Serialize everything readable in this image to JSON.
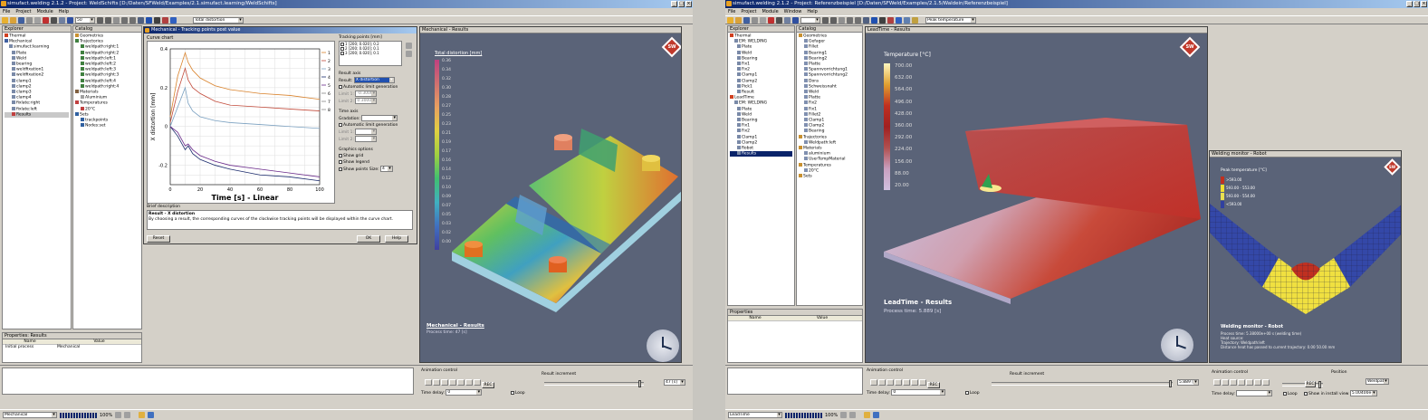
{
  "left_app": {
    "title": "simufact.welding 2.1.2 - Project: WeldSchifts [D:/Daten/SFWeld/Examples/2.1.simufact.learning/WeldSchifts]",
    "menu": [
      "File",
      "Project",
      "Module",
      "Help"
    ],
    "toolbar_combo_zoom": "50",
    "toolbar_combo_result": "Total distortion",
    "explorer": {
      "header": "Explorer",
      "items": [
        "Thermal",
        "Mechanical",
        "simufact:learning",
        "Plate",
        "Weld",
        "bearing",
        "weldfixation1",
        "weldfixation2",
        "clamp1",
        "clamp2",
        "clamp3",
        "clamp4",
        "fixlate:right",
        "fixlate:left",
        "Results"
      ]
    },
    "catalog": {
      "header": "Catalog",
      "items": [
        "Geometries",
        "Trajectories",
        "weldpath:right:1",
        "weldpath:right:2",
        "weldpath:left:1",
        "weldpath:left:2",
        "weldpath:left:3",
        "weldpath:right:3",
        "weldpath:left:4",
        "weldpath:right:4",
        "Materials",
        "Aluminium",
        "Temperatures",
        "20°C",
        "Sets",
        "trackpoints",
        "Nodes:set"
      ]
    },
    "properties": {
      "header": "Properties: Results",
      "col_name": "Name",
      "col_value": "Value",
      "row_name": "Initial process",
      "row_value": "Mechanical"
    },
    "status_combo": "Mechanical",
    "status_pct": "100%",
    "dialog": {
      "title": "Mechanical - Tracking points post value",
      "curve_chart": "Curve chart",
      "tracking_points": "Tracking points [mm]",
      "tp_rows": [
        "1  [200; 0.020]; 0.2",
        "2  [200; 0.020]; 0.1",
        "3  [200; 0.020]; 0.1"
      ],
      "result_axis": "Result axis",
      "result_label": "Result:",
      "result_value": "X distortion",
      "auto_limit_1": "Automatic limit generation",
      "limit1": "Limit 1:",
      "limit2": "Limit 2:",
      "limit1_val": "-0.3000",
      "limit2_val": "0.3000",
      "time_axis": "Time axis",
      "gradation": "Gradation:",
      "auto_limit_2": "Automatic limit generation",
      "graphics_options": "Graphics options",
      "show_grid": "Show grid",
      "show_legend": "Show legend",
      "show_points": "Show points",
      "size": "Size:",
      "size_val": "4",
      "brief_description": "Brief description",
      "desc_title": "Result - X distortion",
      "desc_text": "By choosing a result, the corresponding curves of the clockwise tracking points will be displayed within the curve chart.",
      "reset": "Reset",
      "ok": "OK",
      "help": "Help"
    },
    "chart_data": {
      "type": "line",
      "xlabel": "Time [s] - Linear",
      "ylabel": "X distortion [mm]",
      "xlim": [
        0,
        100
      ],
      "ylim": [
        -0.3,
        0.4
      ],
      "xticks": [
        "0",
        "20",
        "40",
        "60",
        "80",
        "100"
      ],
      "yticks": [
        "0.4",
        "0.2",
        "0",
        "-0.2"
      ],
      "legend": [
        "1",
        "2",
        "3",
        "4",
        "5",
        "6",
        "7",
        "8"
      ],
      "series": [
        {
          "name": "1",
          "color": "#d9822b",
          "x": [
            0,
            5,
            10,
            12,
            15,
            20,
            30,
            40,
            60,
            80,
            100
          ],
          "y": [
            0.05,
            0.26,
            0.38,
            0.33,
            0.29,
            0.25,
            0.21,
            0.19,
            0.17,
            0.16,
            0.14
          ]
        },
        {
          "name": "2",
          "color": "#c24a3a",
          "x": [
            0,
            5,
            10,
            12,
            15,
            20,
            30,
            40,
            60,
            80,
            100
          ],
          "y": [
            0.02,
            0.18,
            0.3,
            0.24,
            0.2,
            0.17,
            0.13,
            0.11,
            0.1,
            0.09,
            0.08
          ]
        },
        {
          "name": "3",
          "color": "#7aa0c0",
          "x": [
            0,
            5,
            10,
            12,
            15,
            20,
            30,
            40,
            60,
            80,
            100
          ],
          "y": [
            0.0,
            0.1,
            0.2,
            0.12,
            0.08,
            0.05,
            0.03,
            0.02,
            0.01,
            0.0,
            -0.01
          ]
        },
        {
          "name": "4",
          "color": "#1a2a6c",
          "x": [
            0,
            5,
            10,
            12,
            15,
            20,
            30,
            40,
            60,
            80,
            100
          ],
          "y": [
            0.0,
            -0.05,
            -0.12,
            -0.1,
            -0.14,
            -0.17,
            -0.2,
            -0.22,
            -0.25,
            -0.26,
            -0.28
          ]
        },
        {
          "name": "5",
          "color": "#6a2a8a",
          "x": [
            0,
            5,
            10,
            12,
            15,
            20,
            30,
            40,
            60,
            80,
            100
          ],
          "y": [
            0.0,
            -0.03,
            -0.1,
            -0.09,
            -0.12,
            -0.15,
            -0.18,
            -0.2,
            -0.22,
            -0.24,
            -0.26
          ]
        }
      ]
    },
    "viewport": {
      "title": "Mechanical - Results",
      "legend_title": "Total distortion [mm]",
      "legend_ticks": [
        "0.36",
        "0.34",
        "0.32",
        "0.30",
        "0.28",
        "0.27",
        "0.25",
        "0.23",
        "0.21",
        "0.19",
        "0.17",
        "0.16",
        "0.14",
        "0.12",
        "0.10",
        "0.09",
        "0.07",
        "0.05",
        "0.03",
        "0.02",
        "0.00"
      ],
      "caption": "Mechanical - Results",
      "sub": "Process time: 47 [s]",
      "logo": "SW"
    },
    "anim": {
      "title": "Animation control",
      "time_delay": "Time delay:",
      "time_delay_val": "0",
      "loop": "Loop",
      "rec": "REC",
      "increment": "Result increment",
      "inc_val": "47 [s]"
    }
  },
  "right_app": {
    "title": "simufact.welding 2.1.2 - Project: Referenzbeispiel [D:/Daten/SFWeld/Examples/2.1.5/Waldein/Referenzbeispiel]",
    "menu": [
      "File",
      "Project",
      "Module",
      "Window",
      "Help"
    ],
    "toolbar_combo_result": "Peak temperature",
    "explorer": {
      "header": "Explorer",
      "items": [
        "Thermal",
        "EM: WELDING",
        "Plate",
        "Weld",
        "Bearing",
        "Fix1",
        "Fix2",
        "Clamp1",
        "Clamp2",
        "Pick1",
        "Result",
        "LeadTime",
        "EM: WELDING",
        "Plate",
        "Weld",
        "Bearing",
        "Fix1",
        "Fix2",
        "Clamp1",
        "Clamp2",
        "Robot",
        "Results"
      ]
    },
    "catalog": {
      "header": "Catalog",
      "items": [
        "Geometries",
        "Gefager",
        "Fillet",
        "Bearing1",
        "Bearing2",
        "Platte",
        "Spannvorrichtung1",
        "Spannvorrichtung2",
        "Dora",
        "Schweissnaht",
        "Weld",
        "Platte",
        "Fix2",
        "Fix1",
        "Fillet2",
        "Clamp1",
        "Clamp2",
        "Bearing",
        "Trajectories",
        "Weldpath:left",
        "Materials",
        "aluminium",
        "UserTempMaterial",
        "Temperatures",
        "20°C",
        "Sets"
      ]
    },
    "properties": {
      "header": "Properties",
      "col_name": "Name",
      "col_value": "Value"
    },
    "status_combo": "LeadTime",
    "status_pct": "100%",
    "viewport": {
      "title": "LeadTime - Results",
      "legend_title": "Temperature [°C]",
      "legend_ticks": [
        "700.00",
        "632.00",
        "564.00",
        "496.00",
        "428.00",
        "360.00",
        "292.00",
        "224.00",
        "156.00",
        "88.00",
        "20.00"
      ],
      "caption": "LeadTime - Results",
      "sub": "Process time: 5.889 [s]",
      "logo": "SW"
    },
    "monitor": {
      "title": "Welding monitor - Robot",
      "legend_title": "Peak temperature [°C]",
      "legend_items": [
        ">593.00",
        "593.00 - 553.00",
        "593.00 - 554.00",
        "<593.00"
      ],
      "caption": "Welding monitor - Robot",
      "lines": [
        "Process time: 5.38000e+00 s (welding time)",
        "Heat source:",
        "Trajectory: Weldpath:left",
        "Distance heat has passed to current trajectory: 0.00  50.00 mm"
      ],
      "logo": "SW"
    },
    "anim": {
      "title": "Animation control",
      "time_delay": "Time delay:",
      "time_delay_val": "0",
      "loop": "Loop",
      "rec": "REC",
      "increment": "Result increment",
      "inc_val": "5.889 [s]"
    },
    "anim2": {
      "title": "Animation control",
      "position": "Position",
      "pos_combo": "Weldpath",
      "time_delay": "Time delay:",
      "loop": "Loop",
      "show_install": "Show in install view",
      "rec": "REC",
      "pos_val": "5.00400e+01"
    }
  },
  "colors": {
    "viewport": "#5a6378",
    "titlebar": "#0a246a",
    "accent": "#c0392b"
  }
}
